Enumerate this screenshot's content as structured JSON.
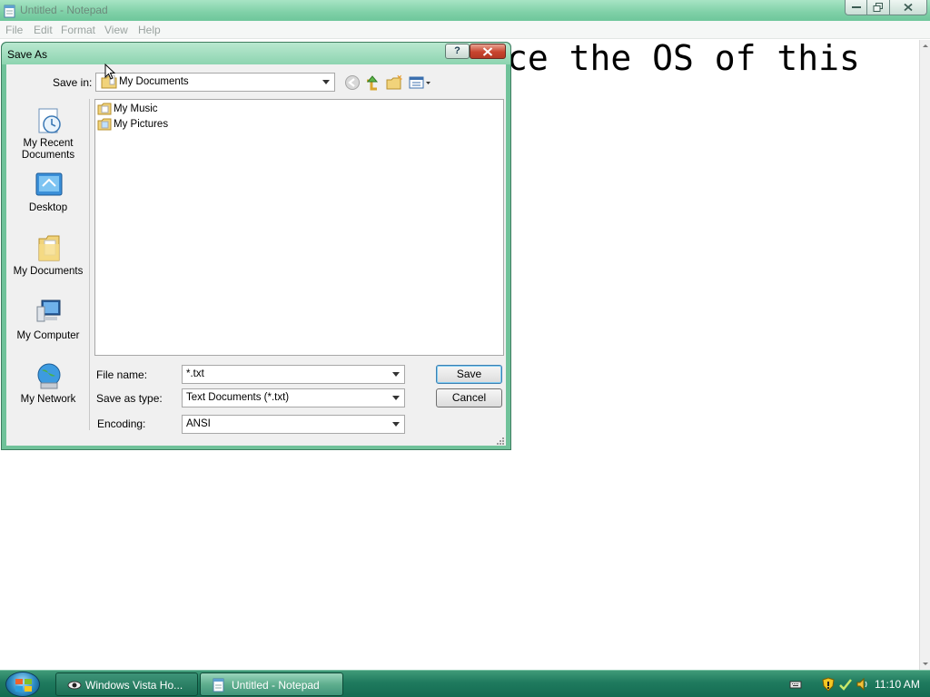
{
  "notepad": {
    "title": "Untitled - Notepad",
    "menu": [
      "File",
      "Edit",
      "Format",
      "View",
      "Help"
    ],
    "visible_text": "ce the OS of this"
  },
  "dialog": {
    "title": "Save As",
    "help_label": "?",
    "save_in_label": "Save in:",
    "save_in_value": "My Documents",
    "places": [
      {
        "label": "My Recent Documents",
        "icon": "recent-documents-icon"
      },
      {
        "label": "Desktop",
        "icon": "desktop-icon"
      },
      {
        "label": "My Documents",
        "icon": "my-documents-icon"
      },
      {
        "label": "My Computer",
        "icon": "my-computer-icon"
      },
      {
        "label": "My Network",
        "icon": "my-network-icon"
      }
    ],
    "files": [
      {
        "name": "My Music"
      },
      {
        "name": "My Pictures"
      }
    ],
    "file_name_label": "File name:",
    "file_name_value": "*.txt",
    "save_as_type_label": "Save as type:",
    "save_as_type_value": "Text Documents (*.txt)",
    "encoding_label": "Encoding:",
    "encoding_value": "ANSI",
    "save_button": "Save",
    "cancel_button": "Cancel"
  },
  "taskbar": {
    "tasks": [
      {
        "label": "Windows Vista Ho...",
        "icon": "browser-icon",
        "active": false
      },
      {
        "label": "Untitled - Notepad",
        "icon": "notepad-icon",
        "active": true
      }
    ],
    "clock": "11:10 AM"
  },
  "colors": {
    "window_frame": "#70c29a",
    "taskbar": "#1f7a5e",
    "dialog_close": "#c8452f"
  }
}
